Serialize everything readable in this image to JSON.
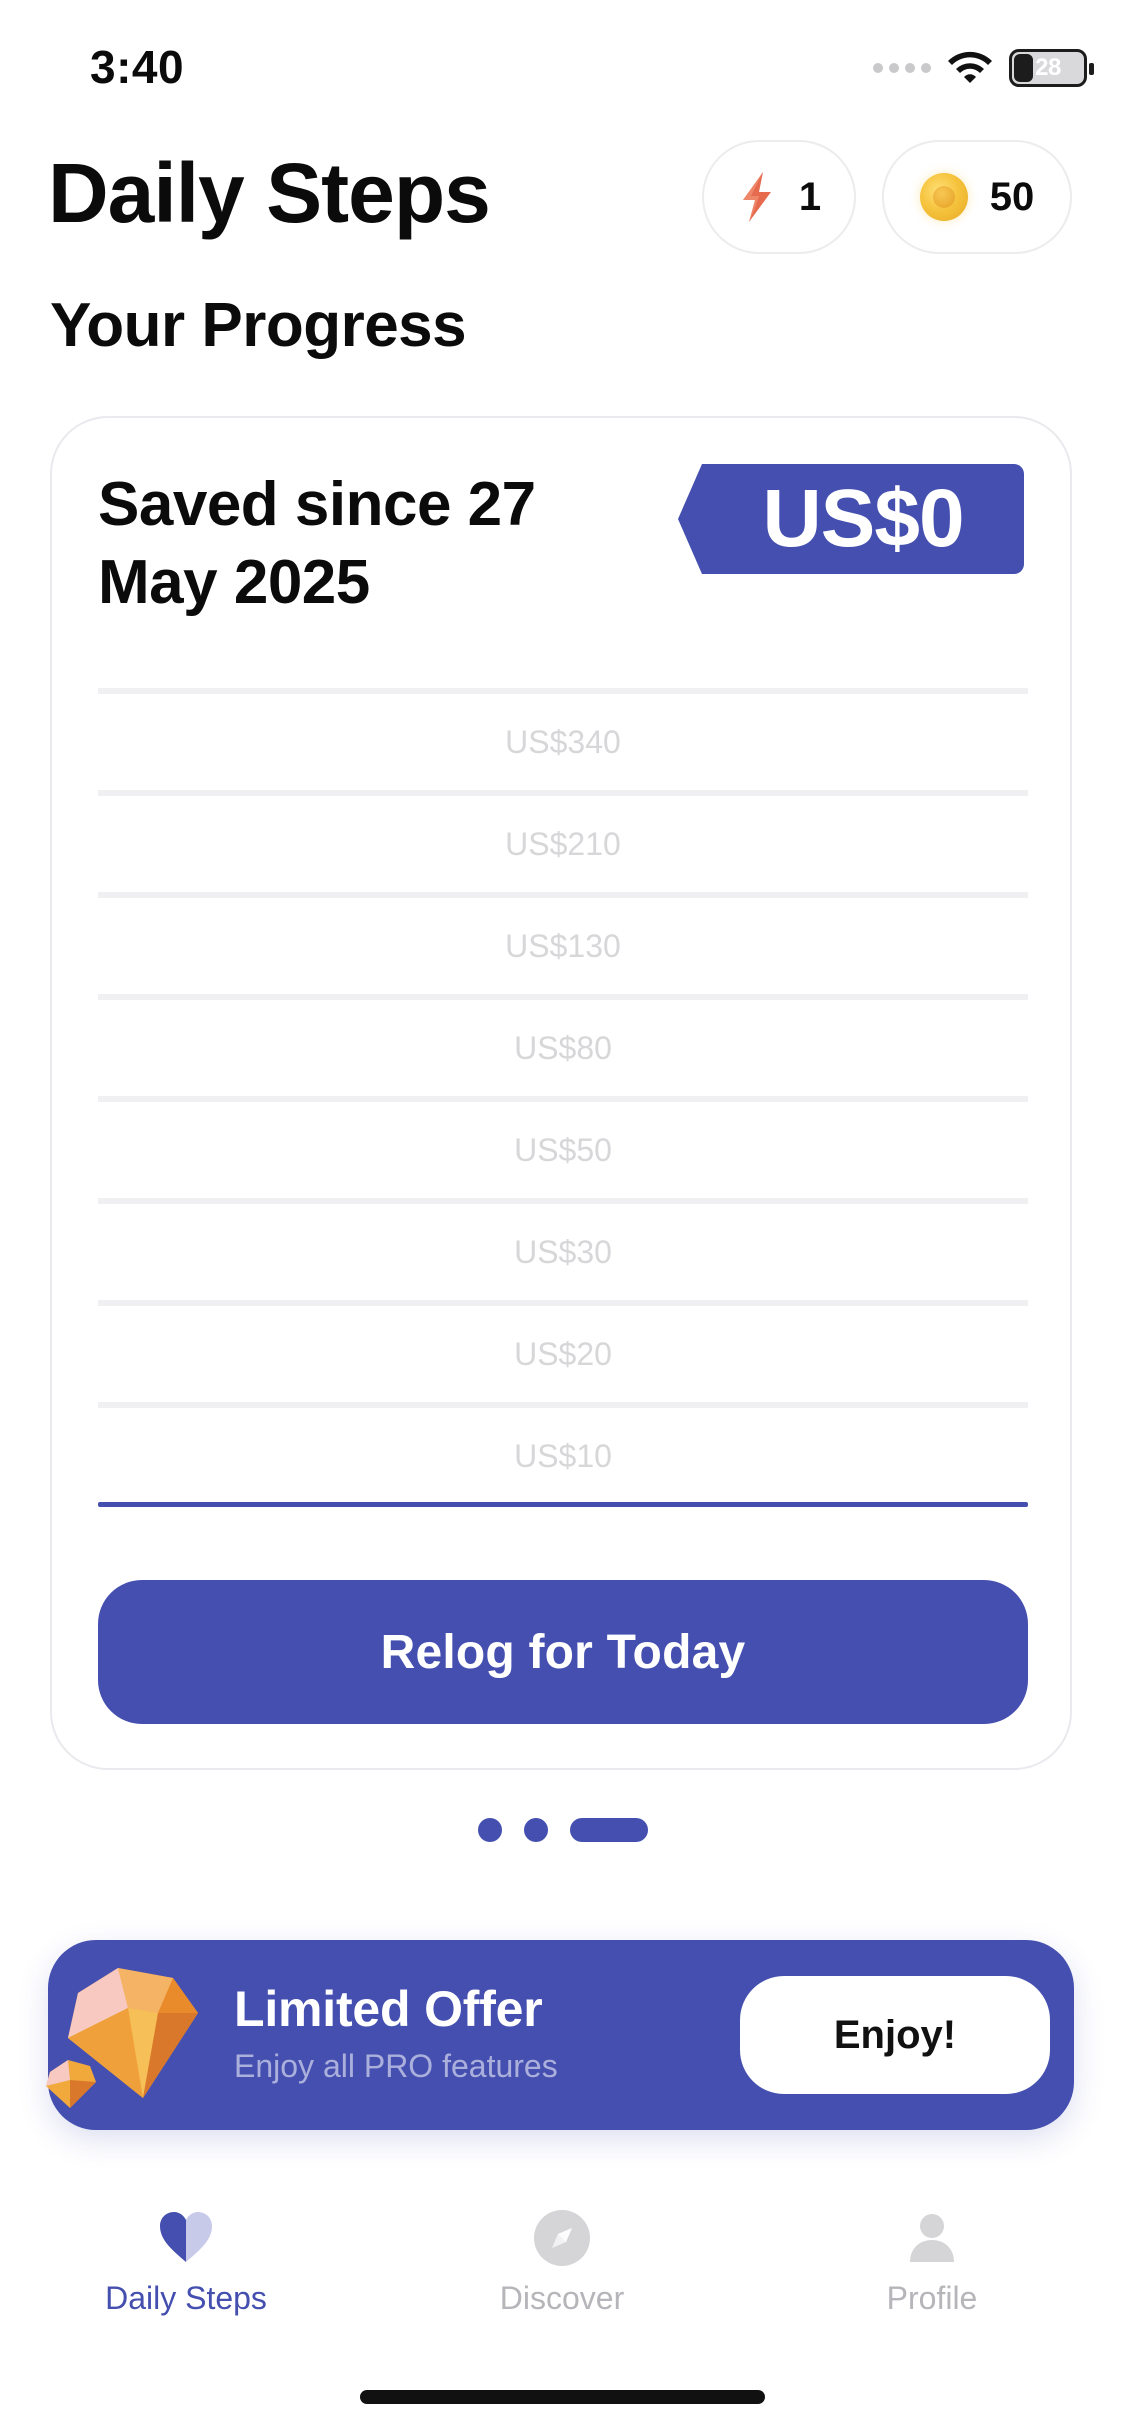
{
  "status_bar": {
    "time": "3:40",
    "battery": "28"
  },
  "header": {
    "title": "Daily Steps",
    "energy_count": "1",
    "coin_count": "50"
  },
  "section": {
    "title": "Your Progress"
  },
  "card": {
    "saved_label": "Saved since 27 May 2025",
    "amount": "US$0",
    "levels": [
      "US$340",
      "US$210",
      "US$130",
      "US$80",
      "US$50",
      "US$30",
      "US$20",
      "US$10"
    ],
    "relog_button": "Relog for Today"
  },
  "pager": {
    "count": 3,
    "active_index": 2
  },
  "offer": {
    "title": "Limited Offer",
    "subtitle": "Enjoy all PRO features",
    "button": "Enjoy!"
  },
  "tabs": [
    {
      "label": "Daily Steps",
      "icon": "heart-icon",
      "active": true
    },
    {
      "label": "Discover",
      "icon": "compass-icon",
      "active": false
    },
    {
      "label": "Profile",
      "icon": "person-icon",
      "active": false
    }
  ],
  "colors": {
    "accent": "#444FB0",
    "text": "#0B0B0B",
    "muted": "#B5B5BA",
    "level_text": "#D7D7DA"
  }
}
